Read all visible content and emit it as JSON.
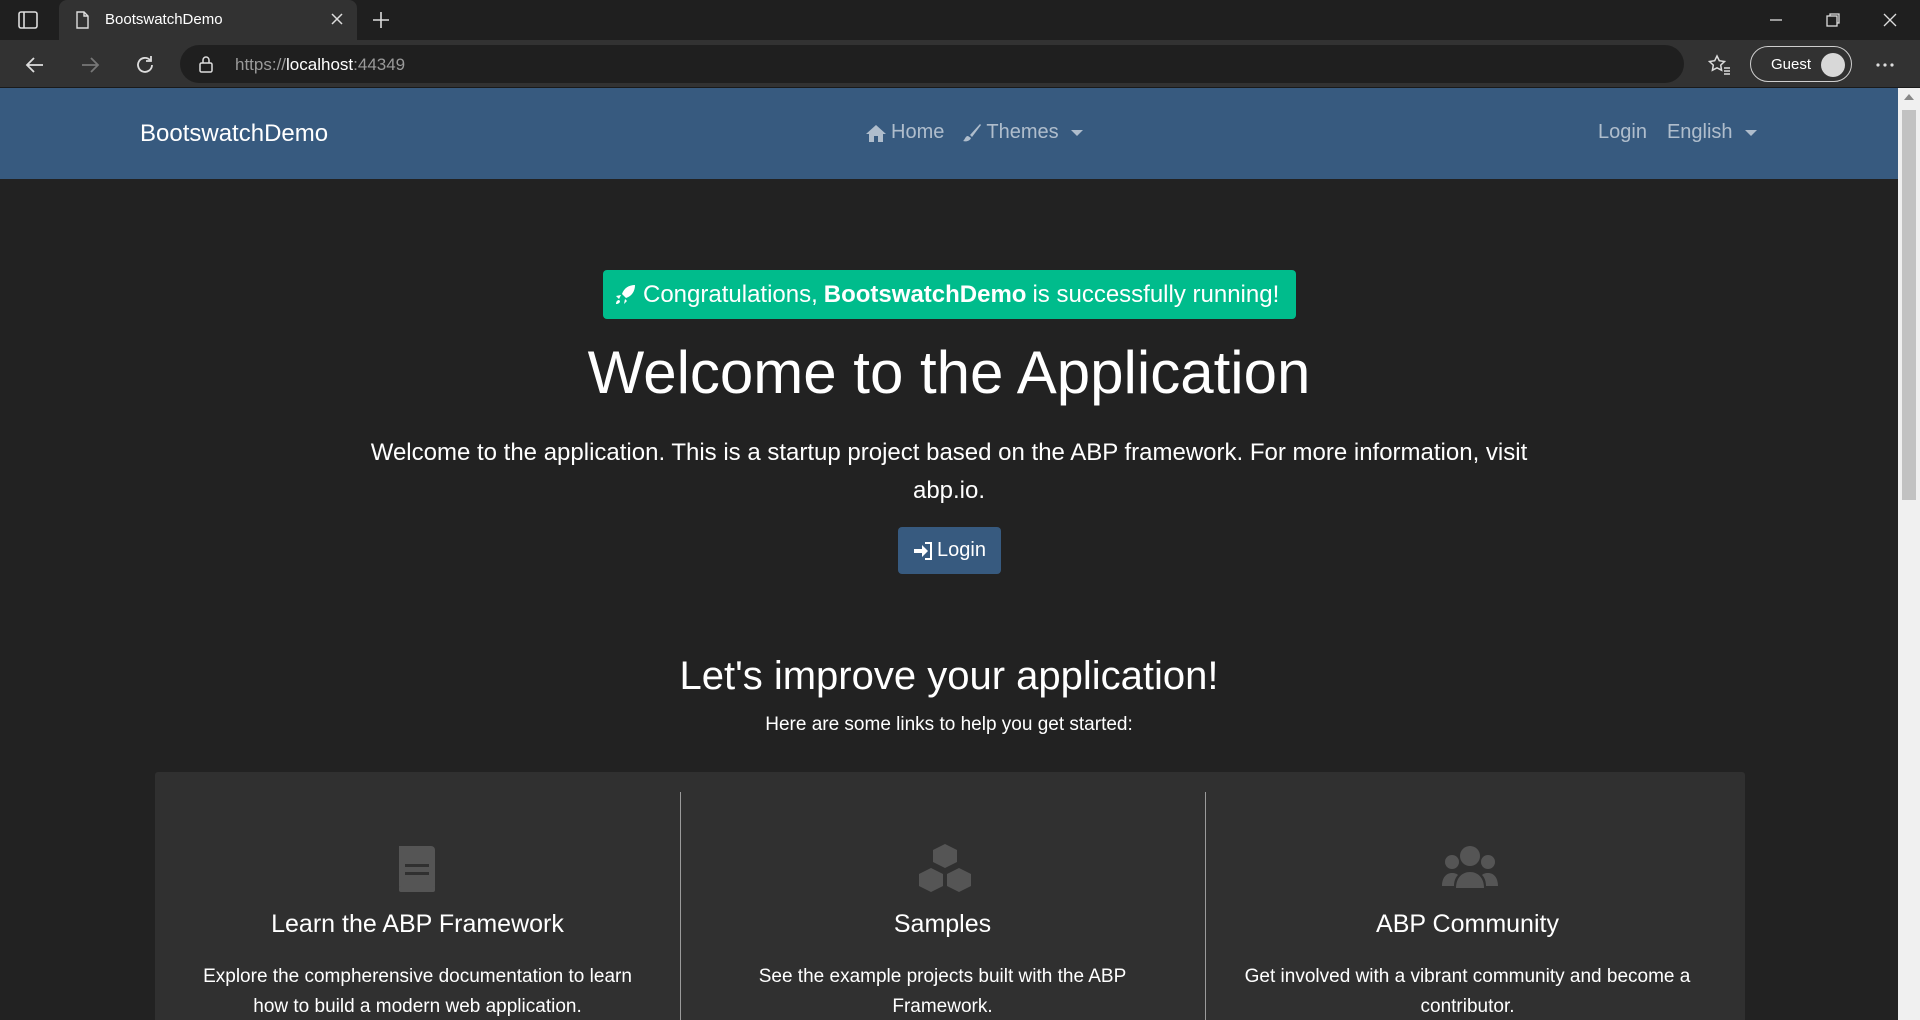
{
  "browser": {
    "tab_title": "BootswatchDemo",
    "url_prefix": "https://",
    "url_host": "localhost",
    "url_port": ":44349",
    "profile_label": "Guest"
  },
  "navbar": {
    "brand": "BootswatchDemo",
    "home_label": "Home",
    "themes_label": "Themes",
    "login_label": "Login",
    "language_label": "English"
  },
  "hero": {
    "alert_prefix": "Congratulations,",
    "alert_app": "BootswatchDemo",
    "alert_suffix": "is successfully running!",
    "title": "Welcome to the Application",
    "text": "Welcome to the application. This is a startup project based on the ABP framework. For more information, visit abp.io.",
    "login_button": "Login"
  },
  "section": {
    "title": "Let's improve your application!",
    "subtitle": "Here are some links to help you get started:"
  },
  "cards": [
    {
      "icon": "book-icon",
      "title": "Learn the ABP Framework",
      "text": "Explore the compherensive documentation to learn how to build a modern web application."
    },
    {
      "icon": "cubes-icon",
      "title": "Samples",
      "text": "See the example projects built with the ABP Framework."
    },
    {
      "icon": "users-icon",
      "title": "ABP Community",
      "text": "Get involved with a vibrant community and become a contributor."
    }
  ],
  "colors": {
    "navbar": "#375a7f",
    "background": "#222222",
    "success": "#00bc8c",
    "card": "#303030"
  }
}
